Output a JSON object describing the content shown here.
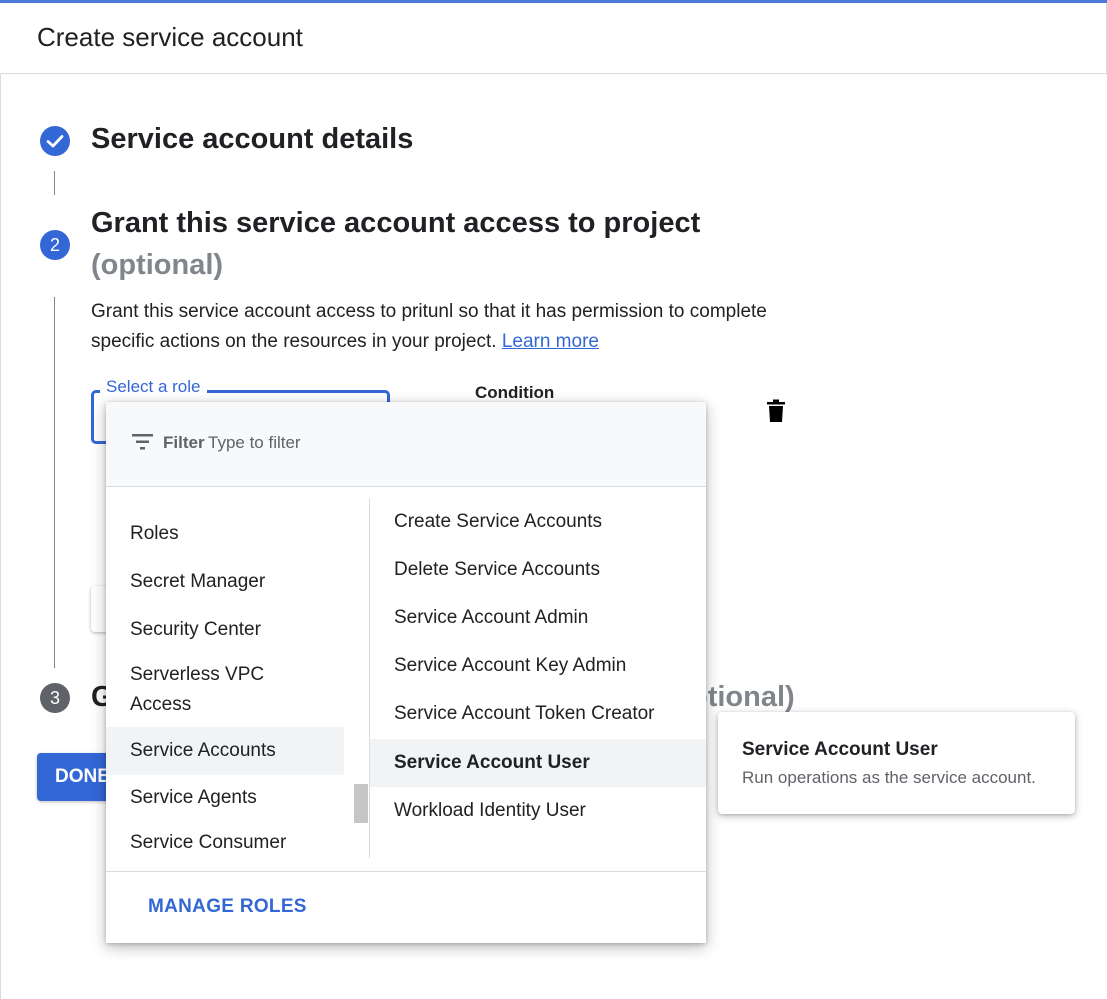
{
  "header": {
    "title": "Create service account"
  },
  "steps": {
    "step1": {
      "title": "Service account details"
    },
    "step2": {
      "number": "2",
      "title": "Grant this service account access to project",
      "optional": "(optional)",
      "description": "Grant this service account access to pritunl so that it has permission to complete specific actions on the resources in your project.",
      "learn_more": "Learn more"
    },
    "step3": {
      "number": "3",
      "title_start": "G",
      "title_end": "otional)"
    }
  },
  "role_field": {
    "label": "Select a role"
  },
  "condition": {
    "label": "Condition"
  },
  "done_button": {
    "label": "DONE"
  },
  "dropdown": {
    "filter_label": "Filter",
    "filter_placeholder": "Type to filter",
    "categories": [
      "Roles",
      "Secret Manager",
      "Security Center",
      "Serverless VPC Access",
      "Service Accounts",
      "Service Agents",
      "Service Consumer"
    ],
    "selected_category": "Service Accounts",
    "roles": [
      "Create Service Accounts",
      "Delete Service Accounts",
      "Service Account Admin",
      "Service Account Key Admin",
      "Service Account Token Creator",
      "Service Account User",
      "Workload Identity User"
    ],
    "highlighted_role": "Service Account User",
    "manage_roles": "MANAGE ROLES"
  },
  "tooltip": {
    "title": "Service Account User",
    "description": "Run operations as the service account."
  },
  "colors": {
    "accent": "#3367d6",
    "step_inactive": "#5f6368",
    "optional_text": "#80868b"
  },
  "icons": [
    "check-icon",
    "trash-icon",
    "filter-icon"
  ]
}
